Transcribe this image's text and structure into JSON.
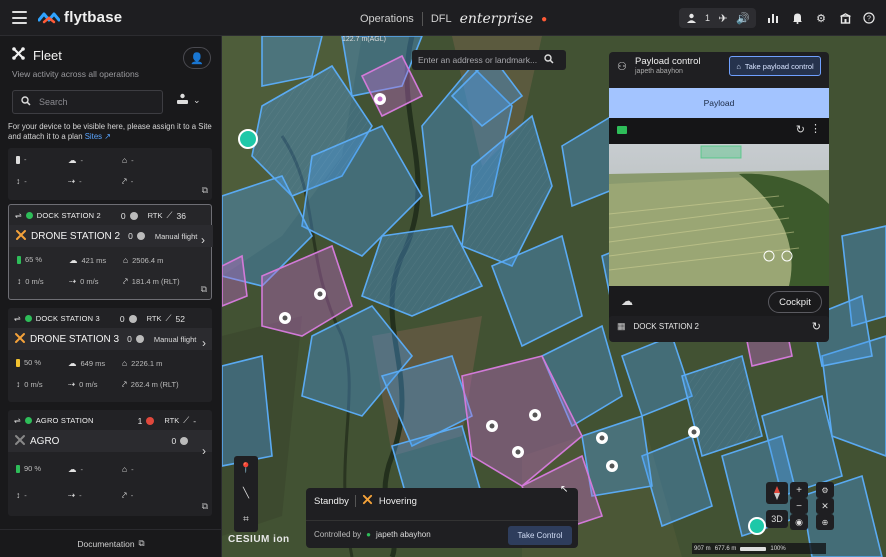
{
  "topbar": {
    "brand": "flytbase",
    "nav_item": "Operations",
    "org": "DFL",
    "product": "enterprise",
    "user_count": "1",
    "icons": [
      "users-icon",
      "drone-status-icon",
      "sound-icon",
      "stats-icon",
      "bell-icon",
      "gear-icon",
      "building-icon",
      "help-icon"
    ]
  },
  "sidebar": {
    "title": "Fleet",
    "subtitle": "View activity across all operations",
    "search_placeholder": "Search",
    "notice_text": "For your device to be visible here, please assign it to a Site and attach it to a plan",
    "notice_link": "Sites",
    "docs_label": "Documentation",
    "cards": [
      {
        "dock": "",
        "drone": "",
        "battery": "-",
        "speed_v": "-",
        "speed_h": "-",
        "dist": "-",
        "alt": "-",
        "home": "-"
      },
      {
        "dock": "DOCK STATION 2",
        "dock_count": "0",
        "rtk": "RTK",
        "rtk_value": "36",
        "drone": "DRONE STATION 2",
        "drone_count": "0",
        "mode": "Manual flight",
        "battery": "65 %",
        "dist": "421 ms",
        "home": "2506.4 m",
        "speed_v": "0 m/s",
        "speed_h": "0 m/s",
        "alt": "181.4 m (RLT)"
      },
      {
        "dock": "DOCK STATION 3",
        "dock_count": "0",
        "rtk": "RTK",
        "rtk_value": "52",
        "drone": "DRONE STATION 3",
        "drone_count": "0",
        "mode": "Manual flight",
        "battery": "50 %",
        "dist": "649 ms",
        "home": "2226.1 m",
        "speed_v": "0 m/s",
        "speed_h": "0 m/s",
        "alt": "262.4 m (RLT)"
      },
      {
        "dock": "AGRO STATION",
        "dock_count": "1",
        "rtk": "RTK",
        "rtk_value": "-",
        "drone": "AGRO",
        "drone_count": "0",
        "battery": "90 %",
        "dist": "-",
        "home": "-",
        "speed_v": "-",
        "speed_h": "-",
        "alt": "-"
      }
    ]
  },
  "map": {
    "altitude_label": "122.7 m(AGL)",
    "address_placeholder": "Enter an address or landmark...",
    "attribution": "CESIUM ion",
    "scale_left": "907 m",
    "scale_right": "677.6 m",
    "zoom_label": "100%",
    "view_mode": "3D"
  },
  "payload": {
    "title": "Payload control",
    "operator": "japeth abayhon",
    "take_label": "Take payload control",
    "header": "Payload",
    "cockpit_label": "Cockpit",
    "dock_label": "DOCK STATION 2"
  },
  "flight": {
    "state": "Standby",
    "status": "Hovering",
    "controlled_by_label": "Controlled by",
    "controller": "japeth abayhon",
    "take_control_label": "Take Control"
  },
  "colors": {
    "accent": "#5aa5ff",
    "status_green": "#2ebd59",
    "status_red": "#e0483c",
    "drone_orange": "#f4a23a",
    "payload_header": "#a3c4ff",
    "field_blue": "#4a9be8",
    "field_pink": "#c06ac8"
  }
}
